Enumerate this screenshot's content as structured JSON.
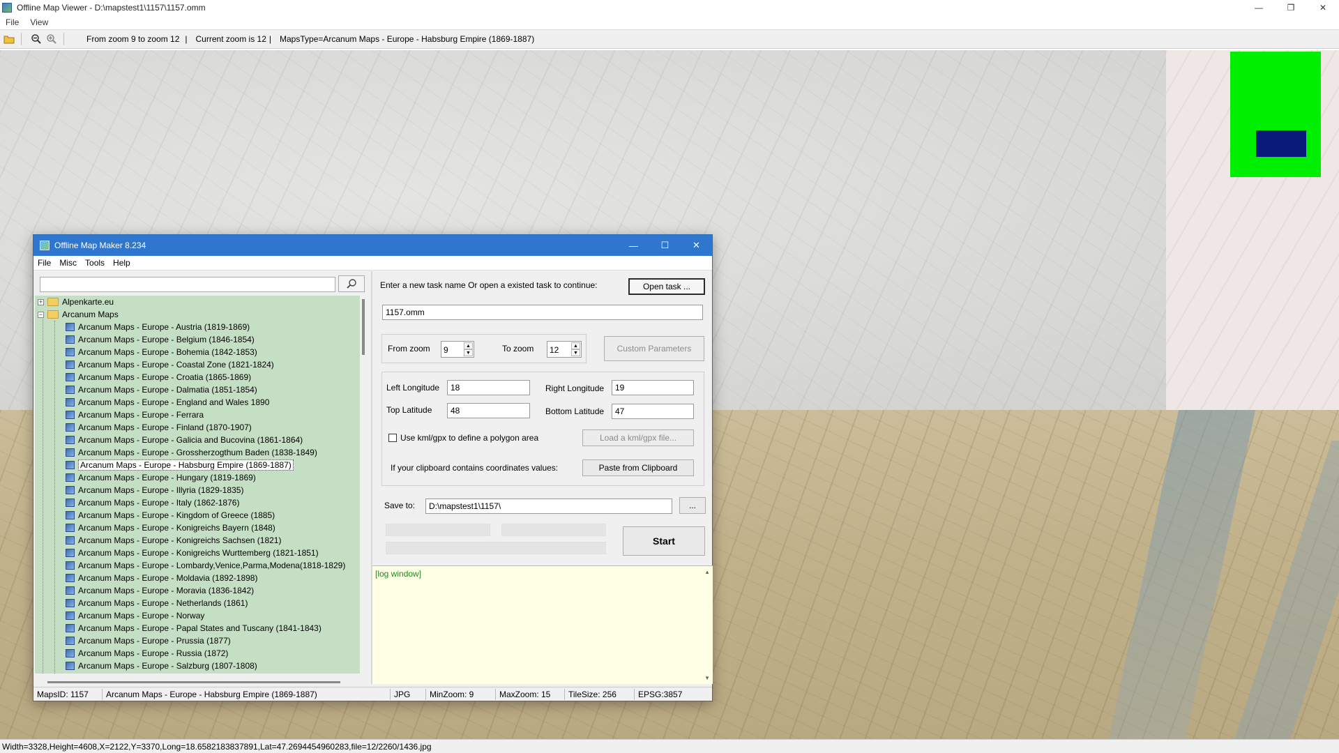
{
  "window": {
    "title": "Offline Map Viewer - D:\\mapstest1\\1157\\1157.omm",
    "minimize": "—",
    "maximize": "❐",
    "close": "✕"
  },
  "menu": [
    "File",
    "View"
  ],
  "toolbar": {
    "zoom_range": "From zoom 9 to zoom 12",
    "current_zoom": "Current zoom is 12",
    "maps_type": "MapsType=Arcanum Maps - Europe - Habsburg Empire (1869-1887)"
  },
  "main_status": "Width=3328,Height=4608,X=2122,Y=3370,Long=18.6582183837891,Lat=47.2694454960283,file=12/2260/1436.jpg",
  "dialog": {
    "title": "Offline Map Maker 8.234",
    "minimize": "—",
    "maximize": "☐",
    "close": "✕",
    "menu": [
      "File",
      "Misc",
      "Tools",
      "Help"
    ],
    "search_value": "",
    "tree": {
      "roots": [
        {
          "label": "Alpenkarte.eu",
          "expanded": false
        },
        {
          "label": "Arcanum Maps",
          "expanded": true
        }
      ],
      "children": [
        "Arcanum Maps - Europe - Austria (1819-1869)",
        "Arcanum Maps - Europe - Belgium (1846-1854)",
        "Arcanum Maps - Europe - Bohemia (1842-1853)",
        "Arcanum Maps - Europe - Coastal Zone (1821-1824)",
        "Arcanum Maps - Europe - Croatia (1865-1869)",
        "Arcanum Maps - Europe - Dalmatia (1851-1854)",
        "Arcanum Maps - Europe - England and Wales 1890",
        "Arcanum Maps - Europe - Ferrara",
        "Arcanum Maps - Europe - Finland (1870-1907)",
        "Arcanum Maps - Europe - Galicia and Bucovina (1861-1864)",
        "Arcanum Maps - Europe - Grossherzogthum Baden (1838-1849)",
        "Arcanum Maps - Europe - Habsburg Empire (1869-1887)",
        "Arcanum Maps - Europe - Hungary (1819-1869)",
        "Arcanum Maps - Europe - Illyria (1829-1835)",
        "Arcanum Maps - Europe - Italy (1862-1876)",
        "Arcanum Maps - Europe - Kingdom of Greece (1885)",
        "Arcanum Maps - Europe - Konigreichs Bayern (1848)",
        "Arcanum Maps - Europe - Konigreichs Sachsen (1821)",
        "Arcanum Maps - Europe - Konigreichs Wurttemberg (1821-1851)",
        "Arcanum Maps - Europe - Lombardy,Venice,Parma,Modena(1818-1829)",
        "Arcanum Maps - Europe - Moldavia (1892-1898)",
        "Arcanum Maps - Europe - Moravia (1836-1842)",
        "Arcanum Maps - Europe - Netherlands (1861)",
        "Arcanum Maps - Europe - Norway",
        "Arcanum Maps - Europe - Papal States and Tuscany (1841-1843)",
        "Arcanum Maps - Europe - Prussia (1877)",
        "Arcanum Maps - Europe - Russia (1872)",
        "Arcanum Maps - Europe - Salzburg (1807-1808)"
      ],
      "selected_index": 11
    },
    "task_prompt": "Enter a new task name Or open a existed task to continue:",
    "open_task_label": "Open task ...",
    "task_name": "1157.omm",
    "from_zoom_label": "From zoom",
    "from_zoom": "9",
    "to_zoom_label": "To zoom",
    "to_zoom": "12",
    "custom_params_label": "Custom Parameters",
    "left_lon_label": "Left Longitude",
    "left_lon": "18",
    "right_lon_label": "Right Longitude",
    "right_lon": "19",
    "top_lat_label": "Top Latitude",
    "top_lat": "48",
    "bottom_lat_label": "Bottom Latitude",
    "bottom_lat": "47",
    "kml_checkbox_label": "Use kml/gpx to define a polygon area",
    "load_kml_label": "Load a kml/gpx file...",
    "clipboard_prompt": "If your clipboard contains coordinates values:",
    "paste_label": "Paste from Clipboard",
    "save_to_label": "Save to:",
    "save_to": "D:\\mapstest1\\1157\\",
    "browse_label": "...",
    "start_label": "Start",
    "log_text": "[log window]",
    "status": {
      "maps_id": "MapsID: 1157",
      "map_name": "Arcanum Maps - Europe - Habsburg Empire (1869-1887)",
      "format": "JPG",
      "min_zoom": "MinZoom: 9",
      "max_zoom": "MaxZoom: 15",
      "tile_size": "TileSize: 256",
      "epsg": "EPSG:3857"
    }
  },
  "colors": {
    "dialog_title_bg": "#2f76cf",
    "tree_bg": "#c4dfc4",
    "overview_bg": "#00ee00",
    "overview_rect": "#0a1a7a",
    "log_bg": "#ffffe6"
  }
}
